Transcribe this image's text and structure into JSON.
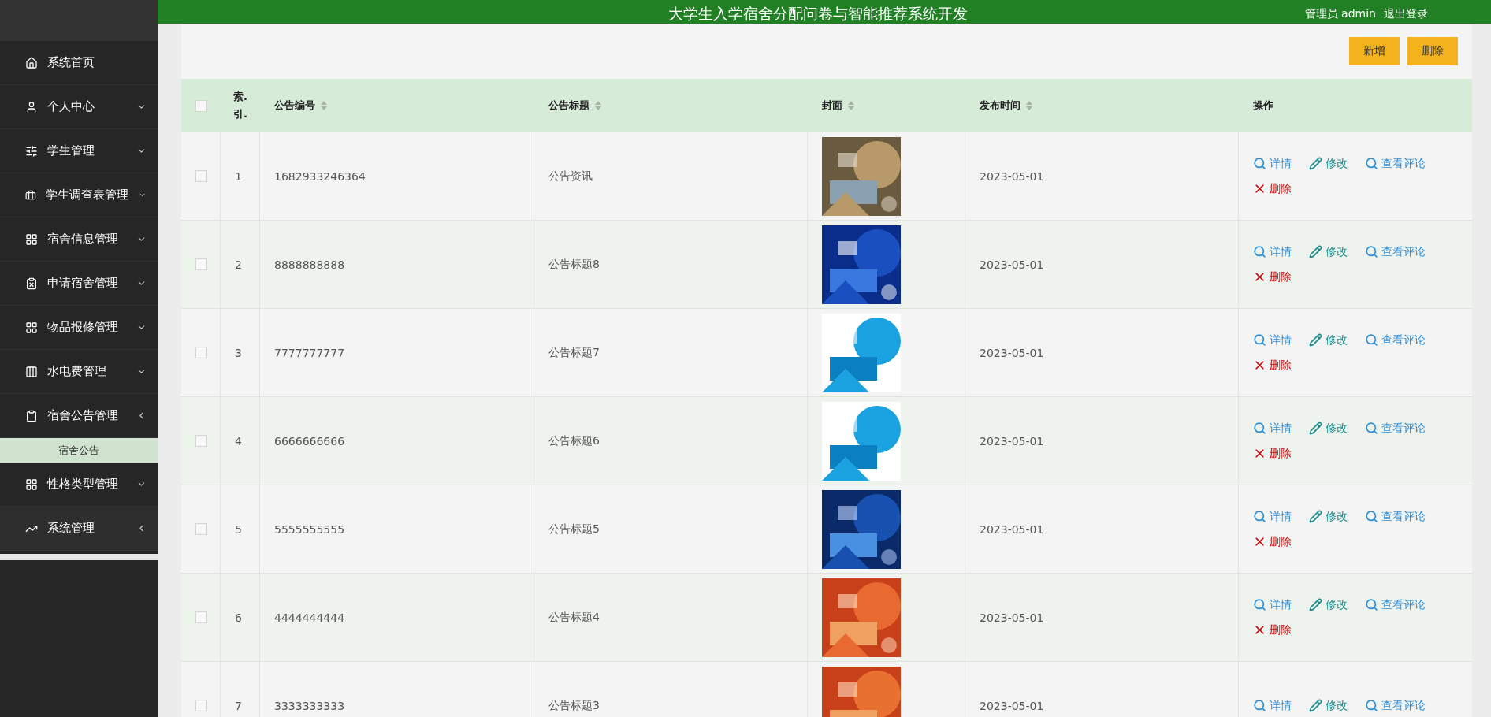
{
  "header": {
    "title": "大学生入学宿舍分配问卷与智能推荐系统开发",
    "user": "管理员 admin",
    "logout": "退出登录"
  },
  "sidebar": {
    "items": [
      {
        "label": "系统首页",
        "has_caret": false
      },
      {
        "label": "个人中心",
        "has_caret": true,
        "expanded": false
      },
      {
        "label": "学生管理",
        "has_caret": true,
        "expanded": false
      },
      {
        "label": "学生调查表管理",
        "has_caret": true,
        "expanded": false
      },
      {
        "label": "宿舍信息管理",
        "has_caret": true,
        "expanded": false
      },
      {
        "label": "申请宿舍管理",
        "has_caret": true,
        "expanded": false
      },
      {
        "label": "物品报修管理",
        "has_caret": true,
        "expanded": false
      },
      {
        "label": "水电费管理",
        "has_caret": true,
        "expanded": false
      },
      {
        "label": "宿舍公告管理",
        "has_caret": true,
        "expanded": true,
        "children": [
          {
            "label": "宿舍公告",
            "selected": true
          }
        ]
      },
      {
        "label": "性格类型管理",
        "has_caret": true,
        "expanded": false
      },
      {
        "label": "系统管理",
        "has_caret": true,
        "expanded": true
      }
    ]
  },
  "toolbar": {
    "buttons": [
      "新增",
      "删除"
    ]
  },
  "table": {
    "select_all": {
      "checked": false
    },
    "columns": [
      {
        "label": "索.\n引.",
        "sortable": false
      },
      {
        "label": "公告编号",
        "sortable": true
      },
      {
        "label": "公告标题",
        "sortable": true
      },
      {
        "label": "封面",
        "sortable": true
      },
      {
        "label": "发布时间",
        "sortable": true
      },
      {
        "label": "操作",
        "sortable": false
      }
    ],
    "rows": [
      {
        "checked": false,
        "index": "1",
        "number": "1682933246364",
        "title": "公告资讯",
        "cover": {
          "kind": "picture"
        },
        "date": "2023-05-01",
        "actions": [
          {
            "kind": "detail",
            "label": "详情"
          },
          {
            "kind": "edit",
            "label": "修改"
          },
          {
            "kind": "comments",
            "label": "查看评论"
          },
          {
            "kind": "delete",
            "label": "删除"
          }
        ]
      },
      {
        "checked": false,
        "index": "2",
        "number": "8888888888",
        "title": "公告标题8",
        "cover": {
          "kind": "picture"
        },
        "date": "2023-05-01",
        "actions": [
          {
            "kind": "detail",
            "label": "详情"
          },
          {
            "kind": "edit",
            "label": "修改"
          },
          {
            "kind": "comments",
            "label": "查看评论"
          },
          {
            "kind": "delete",
            "label": "删除"
          }
        ]
      },
      {
        "checked": false,
        "index": "3",
        "number": "7777777777",
        "title": "公告标题7",
        "cover": {
          "kind": "picture"
        },
        "date": "2023-05-01",
        "actions": [
          {
            "kind": "detail",
            "label": "详情"
          },
          {
            "kind": "edit",
            "label": "修改"
          },
          {
            "kind": "comments",
            "label": "查看评论"
          },
          {
            "kind": "delete",
            "label": "删除"
          }
        ]
      },
      {
        "checked": false,
        "index": "4",
        "number": "6666666666",
        "title": "公告标题6",
        "cover": {
          "kind": "picture"
        },
        "date": "2023-05-01",
        "actions": [
          {
            "kind": "detail",
            "label": "详情"
          },
          {
            "kind": "edit",
            "label": "修改"
          },
          {
            "kind": "comments",
            "label": "查看评论"
          },
          {
            "kind": "delete",
            "label": "删除"
          }
        ]
      },
      {
        "checked": false,
        "index": "5",
        "number": "5555555555",
        "title": "公告标题5",
        "cover": {
          "kind": "picture"
        },
        "date": "2023-05-01",
        "actions": [
          {
            "kind": "detail",
            "label": "详情"
          },
          {
            "kind": "edit",
            "label": "修改"
          },
          {
            "kind": "comments",
            "label": "查看评论"
          },
          {
            "kind": "delete",
            "label": "删除"
          }
        ]
      },
      {
        "checked": false,
        "index": "6",
        "number": "4444444444",
        "title": "公告标题4",
        "cover": {
          "kind": "picture"
        },
        "date": "2023-05-01",
        "actions": [
          {
            "kind": "detail",
            "label": "详情"
          },
          {
            "kind": "edit",
            "label": "修改"
          },
          {
            "kind": "comments",
            "label": "查看评论"
          },
          {
            "kind": "delete",
            "label": "删除"
          }
        ]
      },
      {
        "checked": false,
        "index": "7",
        "number": "3333333333",
        "title": "公告标题3",
        "cover": {
          "kind": "picture"
        },
        "date": "2023-05-01",
        "actions": [
          {
            "kind": "detail",
            "label": "详情"
          },
          {
            "kind": "edit",
            "label": "修改"
          },
          {
            "kind": "comments",
            "label": "查看评论"
          }
        ]
      }
    ]
  }
}
